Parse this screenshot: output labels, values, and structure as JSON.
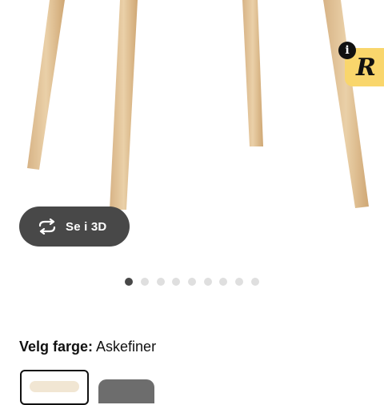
{
  "product": {
    "view_3d_label": "Se i 3D",
    "view_3d_icon": "rotate-360-icon",
    "carousel": {
      "total": 9,
      "active_index": 0
    },
    "color_select": {
      "label": "Velg farge:",
      "selected_value": "Askefiner"
    },
    "swatch_colors": {
      "selected": "#f1e6d3",
      "other": "#6d6d6d"
    }
  },
  "overlay": {
    "info_badge": "i",
    "info_icon": "info-icon",
    "brand_badge_icon": "brand-logo-icon",
    "brand_color": "#f9d66c"
  }
}
